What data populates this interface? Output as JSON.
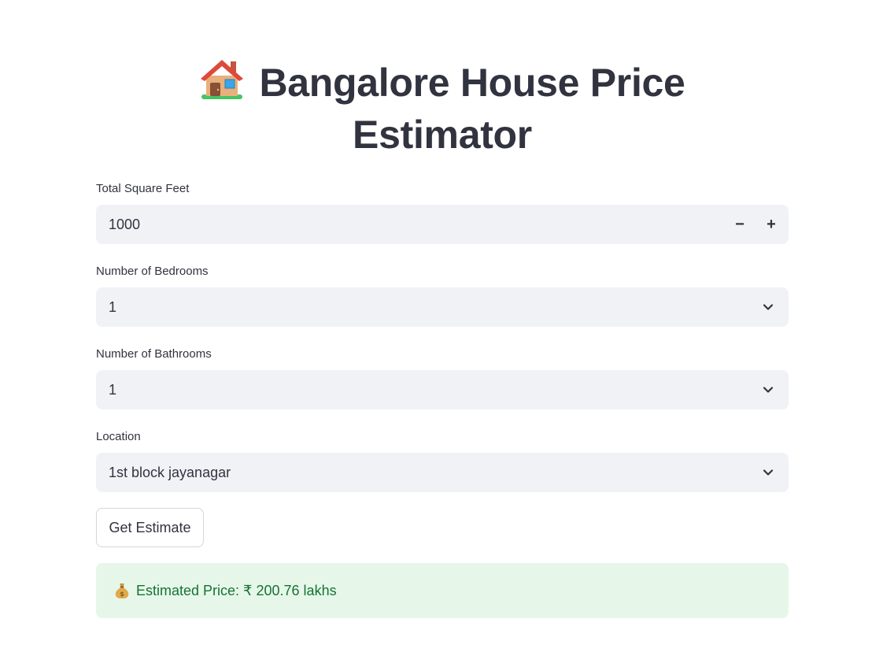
{
  "page": {
    "title": "Bangalore House Price Estimator",
    "title_line1": "Bangalore House Price",
    "title_line2": "Estimator",
    "title_icon": "house-icon"
  },
  "form": {
    "sqft": {
      "label": "Total Square Feet",
      "value": "1000",
      "decrement_label": "−",
      "increment_label": "+"
    },
    "bedrooms": {
      "label": "Number of Bedrooms",
      "value": "1"
    },
    "bathrooms": {
      "label": "Number of Bathrooms",
      "value": "1"
    },
    "location": {
      "label": "Location",
      "value": "1st block jayanagar"
    },
    "submit_label": "Get Estimate"
  },
  "result": {
    "icon": "money-bag-icon",
    "text": "Estimated Price: ₹ 200.76 lakhs"
  },
  "colors": {
    "text": "#31333f",
    "field_bg": "#f0f2f6",
    "success_bg": "#e6f7ea",
    "success_text": "#177233"
  }
}
